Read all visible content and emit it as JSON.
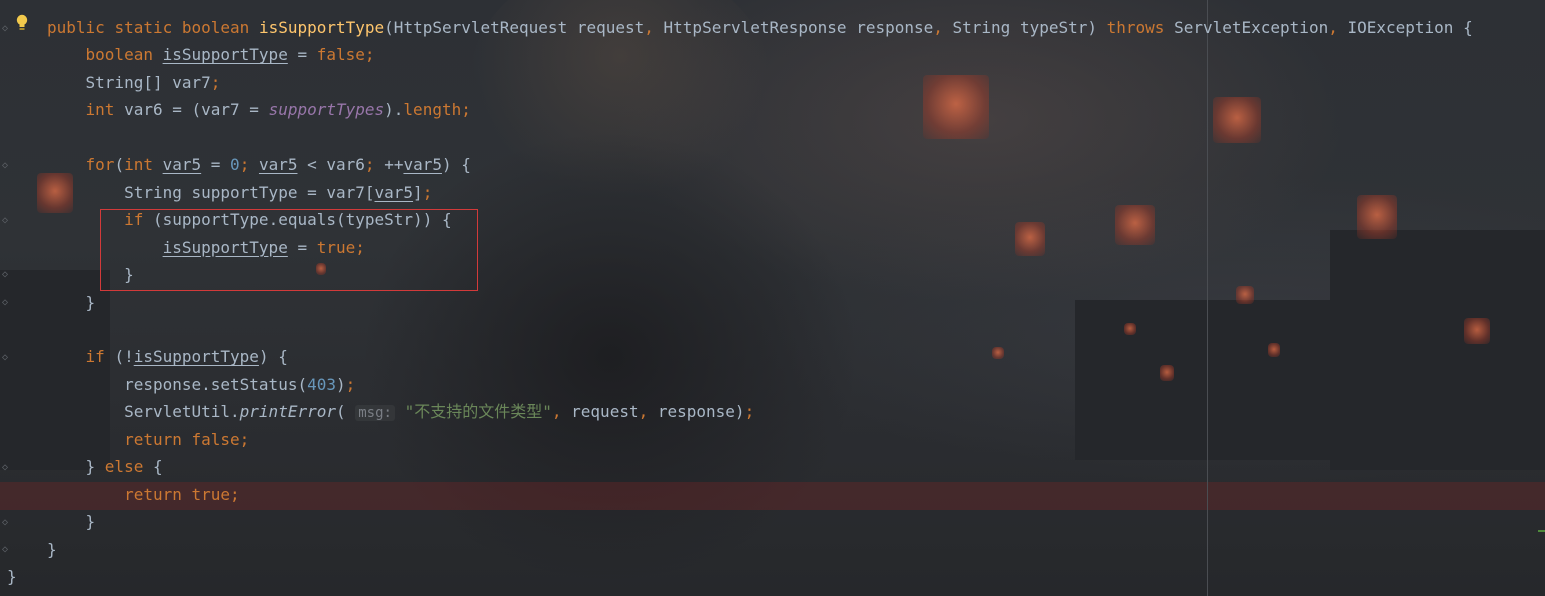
{
  "editor": {
    "lines": [
      {
        "id": "l1",
        "tokens": [
          {
            "t": "public ",
            "c": "kw"
          },
          {
            "t": "static ",
            "c": "kw"
          },
          {
            "t": "boolean ",
            "c": "kw"
          },
          {
            "t": "isSupportType",
            "c": "fn"
          },
          {
            "t": "(HttpServletRequest request",
            "c": ""
          },
          {
            "t": ", ",
            "c": "kw"
          },
          {
            "t": "HttpServletResponse response",
            "c": ""
          },
          {
            "t": ", ",
            "c": "kw"
          },
          {
            "t": "String typeStr) ",
            "c": ""
          },
          {
            "t": "throws ",
            "c": "kw"
          },
          {
            "t": "ServletException",
            "c": ""
          },
          {
            "t": ", ",
            "c": "kw"
          },
          {
            "t": "IOException {",
            "c": ""
          }
        ]
      },
      {
        "id": "l2",
        "tokens": [
          {
            "t": "    boolean ",
            "c": "kw"
          },
          {
            "t": "isSupportType",
            "c": "ul"
          },
          {
            "t": " = ",
            "c": ""
          },
          {
            "t": "false",
            "c": "kw"
          },
          {
            "t": ";",
            "c": "kw"
          }
        ]
      },
      {
        "id": "l3",
        "tokens": [
          {
            "t": "    String[] var7",
            "c": ""
          },
          {
            "t": ";",
            "c": "kw"
          }
        ]
      },
      {
        "id": "l4",
        "tokens": [
          {
            "t": "    int ",
            "c": "kw"
          },
          {
            "t": "var6 = (var7 = ",
            "c": ""
          },
          {
            "t": "supportTypes",
            "c": "fld"
          },
          {
            "t": ").",
            "c": ""
          },
          {
            "t": "length",
            "c": "kw2"
          },
          {
            "t": ";",
            "c": "kw"
          }
        ]
      },
      {
        "id": "l5",
        "tokens": []
      },
      {
        "id": "l6",
        "tokens": [
          {
            "t": "    for",
            "c": "kw"
          },
          {
            "t": "(",
            "c": ""
          },
          {
            "t": "int ",
            "c": "kw"
          },
          {
            "t": "var5",
            "c": "ul"
          },
          {
            "t": " = ",
            "c": ""
          },
          {
            "t": "0",
            "c": "num"
          },
          {
            "t": "; ",
            "c": "kw"
          },
          {
            "t": "var5",
            "c": "ul"
          },
          {
            "t": " < var6",
            "c": ""
          },
          {
            "t": "; ",
            "c": "kw"
          },
          {
            "t": "++",
            "c": ""
          },
          {
            "t": "var5",
            "c": "ul"
          },
          {
            "t": ") {",
            "c": ""
          }
        ]
      },
      {
        "id": "l7",
        "tokens": [
          {
            "t": "        String supportType = var7[",
            "c": ""
          },
          {
            "t": "var5",
            "c": "ul"
          },
          {
            "t": "]",
            "c": ""
          },
          {
            "t": ";",
            "c": "kw"
          }
        ]
      },
      {
        "id": "l8",
        "tokens": [
          {
            "t": "        if ",
            "c": "kw"
          },
          {
            "t": "(supportType.equals(typeStr)) {",
            "c": ""
          }
        ]
      },
      {
        "id": "l9",
        "tokens": [
          {
            "t": "            ",
            "c": ""
          },
          {
            "t": "isSupportType",
            "c": "ul"
          },
          {
            "t": " = ",
            "c": ""
          },
          {
            "t": "true",
            "c": "kw"
          },
          {
            "t": ";",
            "c": "kw"
          }
        ]
      },
      {
        "id": "l10",
        "tokens": [
          {
            "t": "        }",
            "c": ""
          }
        ]
      },
      {
        "id": "l11",
        "tokens": [
          {
            "t": "    }",
            "c": ""
          }
        ]
      },
      {
        "id": "l12",
        "tokens": []
      },
      {
        "id": "l13",
        "tokens": [
          {
            "t": "    if ",
            "c": "kw"
          },
          {
            "t": "(!",
            "c": ""
          },
          {
            "t": "isSupportType",
            "c": "ul"
          },
          {
            "t": ") {",
            "c": ""
          }
        ]
      },
      {
        "id": "l14",
        "tokens": [
          {
            "t": "        response.setStatus(",
            "c": ""
          },
          {
            "t": "403",
            "c": "num"
          },
          {
            "t": ")",
            "c": ""
          },
          {
            "t": ";",
            "c": "kw"
          }
        ]
      },
      {
        "id": "l15",
        "tokens": [
          {
            "t": "        ServletUtil.",
            "c": ""
          },
          {
            "t": "printError",
            "c": "it"
          },
          {
            "t": "( ",
            "c": ""
          },
          {
            "t": "msg:",
            "c": "hint"
          },
          {
            "t": " ",
            "c": ""
          },
          {
            "t": "\"不支持的文件类型\"",
            "c": "str"
          },
          {
            "t": ", ",
            "c": "kw"
          },
          {
            "t": "request",
            "c": ""
          },
          {
            "t": ", ",
            "c": "kw"
          },
          {
            "t": "response)",
            "c": ""
          },
          {
            "t": ";",
            "c": "kw"
          }
        ]
      },
      {
        "id": "l16",
        "tokens": [
          {
            "t": "        return ",
            "c": "kw"
          },
          {
            "t": "false",
            "c": "kw"
          },
          {
            "t": ";",
            "c": "kw"
          }
        ]
      },
      {
        "id": "l17",
        "tokens": [
          {
            "t": "    } ",
            "c": ""
          },
          {
            "t": "else ",
            "c": "kw"
          },
          {
            "t": "{",
            "c": ""
          }
        ]
      },
      {
        "id": "l18",
        "tokens": [
          {
            "t": "        return ",
            "c": "kw"
          },
          {
            "t": "true",
            "c": "kw"
          },
          {
            "t": ";",
            "c": "kw"
          }
        ]
      },
      {
        "id": "l19",
        "tokens": [
          {
            "t": "    }",
            "c": ""
          }
        ]
      },
      {
        "id": "l20",
        "tokens": [
          {
            "t": "}",
            "c": ""
          }
        ]
      },
      {
        "id": "l21",
        "tokens": [
          {
            "t": "}",
            "c": ""
          }
        ]
      }
    ],
    "icons": {
      "intention": "lightbulb-icon",
      "fold": "fold-marker-icon"
    },
    "colors": {
      "keyword": "#cc7832",
      "function": "#ffc66d",
      "number": "#6897bb",
      "string": "#6a8759",
      "field": "#9876aa",
      "text": "#a9b7c6",
      "highlight_box": "#d23a3a",
      "error_line": "#782424"
    }
  }
}
